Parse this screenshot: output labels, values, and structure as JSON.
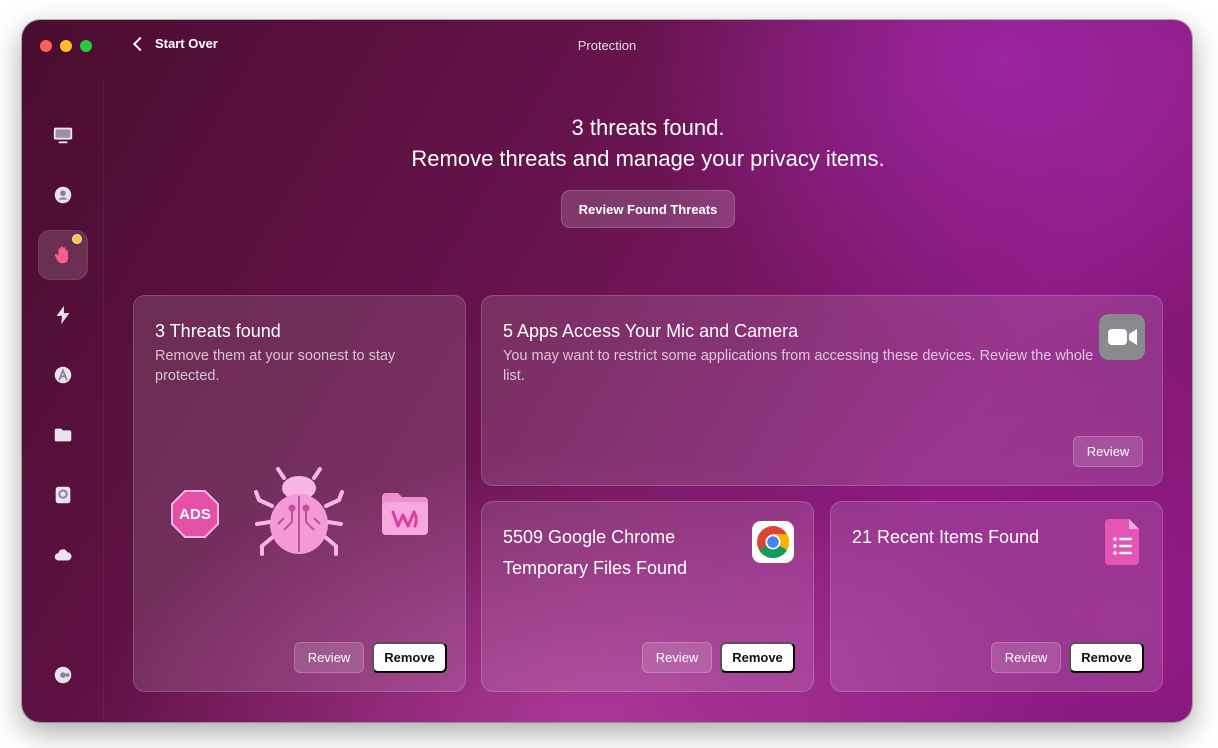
{
  "window": {
    "title": "Protection",
    "back_label": "Start Over"
  },
  "sidebar": {
    "items": [
      {
        "icon": "monitor-icon"
      },
      {
        "icon": "privacy-shield-icon"
      },
      {
        "icon": "hand-icon",
        "active": true,
        "badge": true
      },
      {
        "icon": "lightning-icon"
      },
      {
        "icon": "applications-icon"
      },
      {
        "icon": "folder-icon"
      },
      {
        "icon": "disk-icon"
      },
      {
        "icon": "cloud-icon"
      },
      {
        "icon": "assistant-icon"
      }
    ]
  },
  "hero": {
    "line1": "3 threats found.",
    "line2": "Remove threats and manage your privacy items.",
    "button": "Review Found Threats"
  },
  "cards": {
    "threats": {
      "title": "3 Threats found",
      "desc": "Remove them at your soonest to stay protected.",
      "ads_label": "ADS",
      "review": "Review",
      "remove": "Remove"
    },
    "mic_camera": {
      "title": "5 Apps Access Your Mic and Camera",
      "desc": "You may want to restrict some applications from accessing these devices. Review the whole list.",
      "review": "Review"
    },
    "chrome": {
      "title_line1": "5509 Google Chrome",
      "title_line2": "Temporary Files Found",
      "review": "Review",
      "remove": "Remove"
    },
    "recent": {
      "title": "21 Recent Items Found",
      "review": "Review",
      "remove": "Remove"
    }
  },
  "colors": {
    "accent": "#e86ad0",
    "badge": "#f5c542"
  }
}
